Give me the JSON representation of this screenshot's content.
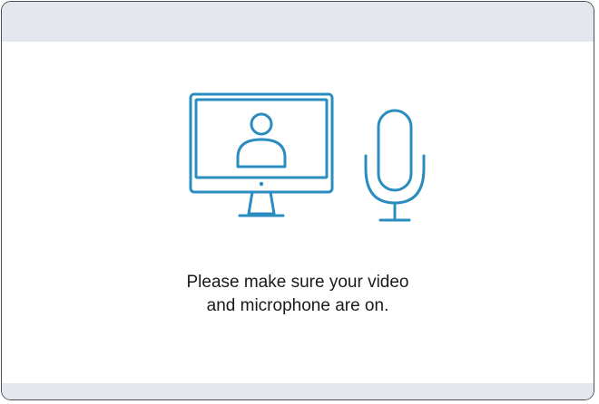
{
  "icons": {
    "monitor": "monitor-user-icon",
    "microphone": "microphone-icon"
  },
  "colors": {
    "icon_stroke": "#2a8cbf",
    "bar_background": "#e4e7ee",
    "text": "#1a1a1a"
  },
  "message": {
    "line1": "Please make sure your video",
    "line2": "and microphone are on."
  }
}
